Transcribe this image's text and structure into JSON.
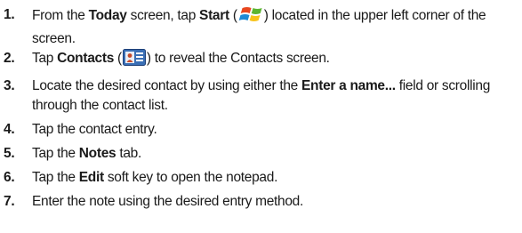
{
  "steps": [
    {
      "number": "1.",
      "parts": {
        "a": "From the ",
        "b_today": "Today",
        "c": " screen, tap ",
        "d_start": "Start",
        "e": " (",
        "icon": "windows-start-icon",
        "f": ") located in the upper left corner of the screen."
      }
    },
    {
      "number": "2.",
      "parts": {
        "a": "Tap ",
        "b_contacts": "Contacts",
        "c": " (",
        "icon": "contacts-icon",
        "d": ") to reveal the Contacts screen."
      }
    },
    {
      "number": "3.",
      "parts": {
        "a": "Locate the desired contact by using either the ",
        "b_enter": "Enter a name...",
        "c": " field or scrolling through the contact list."
      }
    },
    {
      "number": "4.",
      "text": "Tap the contact entry."
    },
    {
      "number": "5.",
      "parts": {
        "a": "Tap the ",
        "b_notes": "Notes",
        "c": " tab."
      }
    },
    {
      "number": "6.",
      "parts": {
        "a": "Tap the ",
        "b_edit": "Edit",
        "c": " soft key to open the notepad."
      }
    },
    {
      "number": "7.",
      "text": "Enter the note using the desired entry method."
    }
  ]
}
